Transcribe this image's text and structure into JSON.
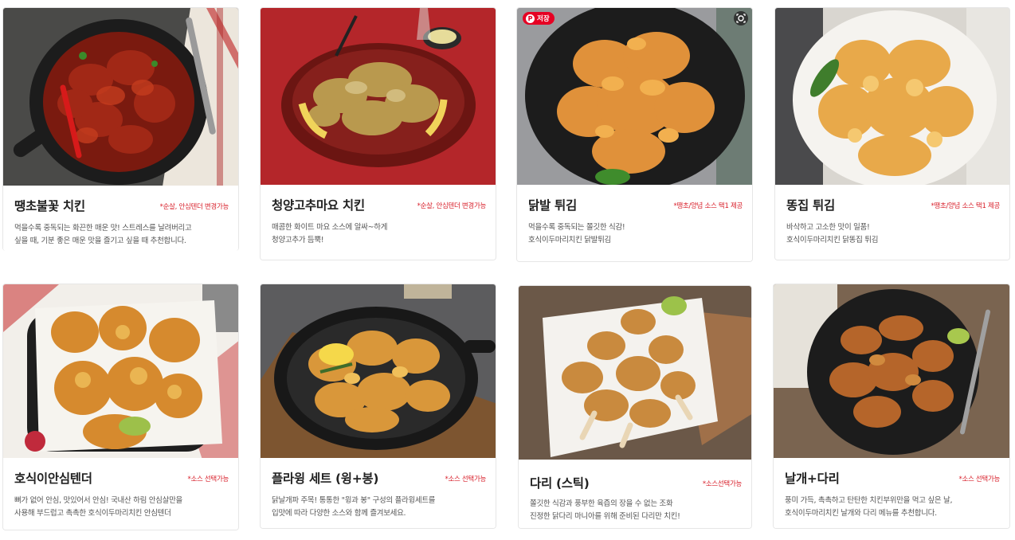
{
  "products": [
    {
      "title": "땡초불꽃 치킨",
      "badge": "*순살, 안심텐더 변경가능",
      "desc": [
        "먹을수록 중독되는 화끈한 매운 맛! 스트레스를 날려버리고",
        "싶을 때, 기분 좋은 매운 맛을 즐기고 싶을 때 추천합니다."
      ],
      "image": "spicy-fire-chicken-photo"
    },
    {
      "title": "청양고추마요 치킨",
      "badge": "*순살, 안심텐더 변경가능",
      "desc": [
        "매콤한 화이트 마요 소스에 알싸~하게",
        "청양고추가 듬뿍!"
      ],
      "image": "cheongyang-mayo-chicken-photo"
    },
    {
      "title": "닭발 튀김",
      "badge": "*땡초/양념 소스 택1 제공",
      "desc": [
        "먹을수록 중독되는 쫄깃한 식감!",
        "호식이두마리치킨 닭발튀김"
      ],
      "image": "fried-chicken-feet-photo",
      "pin_label": "저장"
    },
    {
      "title": "똥집 튀김",
      "badge": "*땡초/양념 소스 택1 제공",
      "desc": [
        "바삭하고 고소한 맛이 일품!",
        "호식이두마리치킨 닭똥집 튀김"
      ],
      "image": "fried-gizzard-photo"
    },
    {
      "title": "호식이안심텐더",
      "badge": "*소스 선택가능",
      "desc": [
        "뼈가 없어 안심, 맛있어서 안심! 국내산 하림 안심살만을",
        "사용해 부드럽고 촉촉한 호식이두마리치킨 안심텐더"
      ],
      "image": "tender-photo"
    },
    {
      "title": "플라윙 세트 (윙+봉)",
      "badge": "*소스 선택가능",
      "desc": [
        "닭날개파 주목! 통통한 \"윙과 봉\" 구성의 플라윙세트를",
        "입맛에 따라 다양한 소스와 함께 즐겨보세요."
      ],
      "image": "wing-set-photo"
    },
    {
      "title": "다리 (스틱)",
      "badge": "*소스선택가능",
      "desc": [
        "쫄깃한 식감과 풍부한 육즙의 장을 수 없는 조화",
        "진정한 닭다리 마니아를 위해 준비된 다리만 치킨!"
      ],
      "image": "drumstick-photo"
    },
    {
      "title": "날개+다리",
      "badge": "*소스 선택가능",
      "desc": [
        "풍미 가득, 촉촉하고 탄탄한 치킨부위만을 먹고 싶은 날,",
        "호식이두마리치킨 날개와 다리 메뉴를 추천합니다."
      ],
      "image": "wing-leg-combo-photo"
    }
  ],
  "colors": {
    "badge": "#d81f2a",
    "pinterest": "#e60023"
  }
}
